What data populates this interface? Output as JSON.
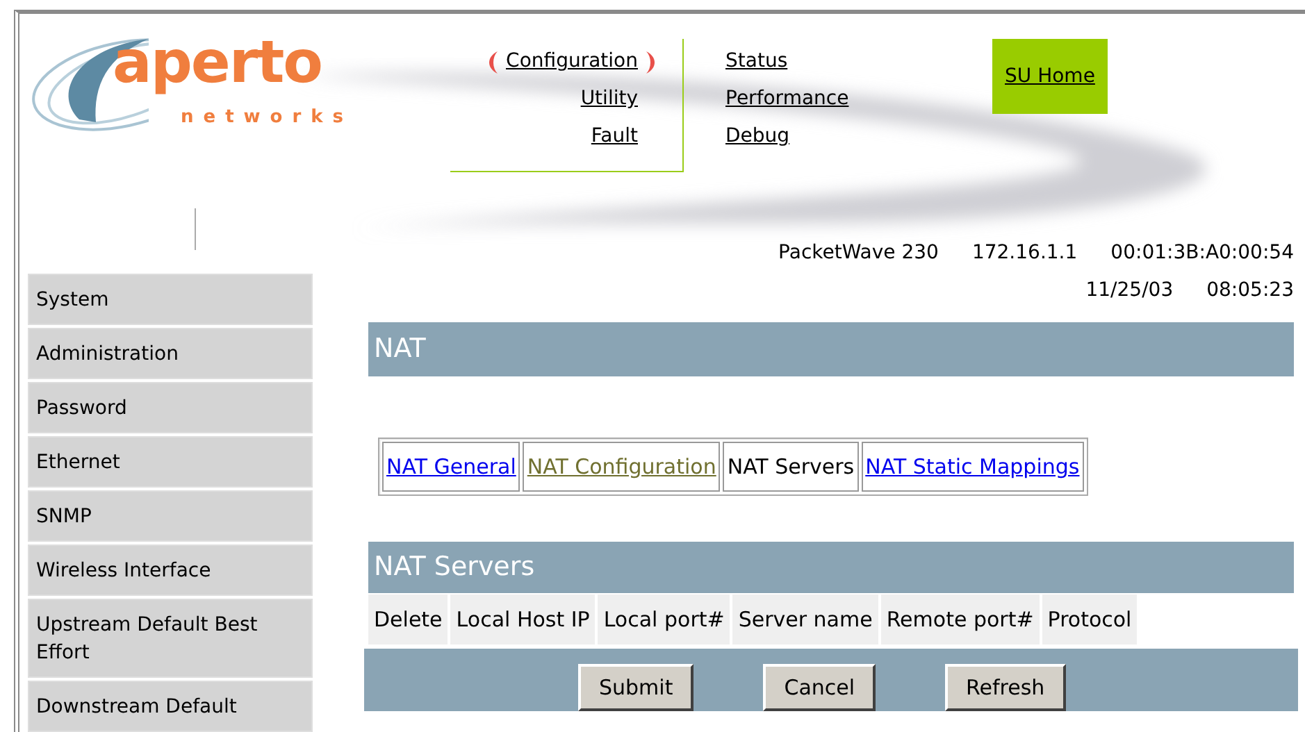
{
  "logo": {
    "name": "aperto",
    "tagline": "networks"
  },
  "nav": {
    "left": [
      {
        "label": "Configuration",
        "selected": true
      },
      {
        "label": "Utility",
        "selected": false
      },
      {
        "label": "Fault",
        "selected": false
      }
    ],
    "right": [
      {
        "label": "Status",
        "selected": false
      },
      {
        "label": "Performance",
        "selected": false
      },
      {
        "label": "Debug",
        "selected": false
      }
    ],
    "home": "SU Home"
  },
  "device": {
    "model": "PacketWave 230",
    "ip": "172.16.1.1",
    "mac": "00:01:3B:A0:00:54",
    "date": "11/25/03",
    "time": "08:05:23"
  },
  "sidebar": {
    "items": [
      "System",
      "Administration",
      "Password",
      "Ethernet",
      "SNMP",
      "Wireless Interface",
      "Upstream Default Best Effort",
      "Downstream Default"
    ]
  },
  "section_title": "NAT",
  "tabs": [
    {
      "label": "NAT General",
      "selected": false,
      "visited": false
    },
    {
      "label": "NAT Configuration",
      "selected": false,
      "visited": true
    },
    {
      "label": "NAT Servers",
      "selected": true
    },
    {
      "label": "NAT Static Mappings",
      "selected": false,
      "visited": false
    }
  ],
  "table": {
    "title": "NAT Servers",
    "columns": [
      "Delete",
      "Local Host IP",
      "Local port#",
      "Server name",
      "Remote port#",
      "Protocol"
    ]
  },
  "buttons": [
    "Submit",
    "Cancel",
    "Refresh"
  ]
}
